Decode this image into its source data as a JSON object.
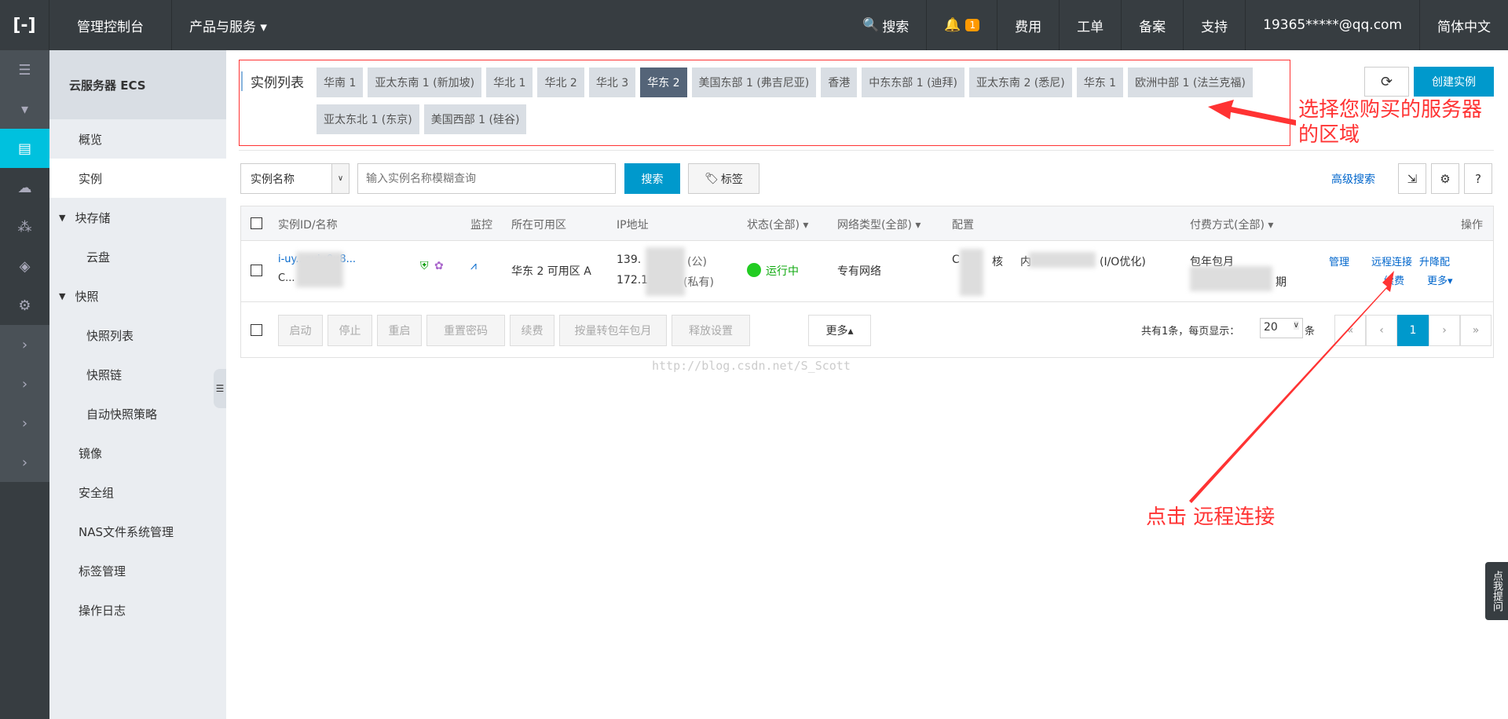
{
  "topbar": {
    "logo": "[-]",
    "console": "管理控制台",
    "products": "产品与服务 ▾",
    "search": "搜索",
    "notif_count": "1",
    "items": [
      "费用",
      "工单",
      "备案",
      "支持"
    ],
    "user": "19365*****@qq.com",
    "lang": "简体中文"
  },
  "sidebar": {
    "title": "云服务器 ECS",
    "items": [
      {
        "label": "概览",
        "type": "item"
      },
      {
        "label": "实例",
        "type": "sel"
      },
      {
        "label": "块存储",
        "type": "grp"
      },
      {
        "label": "云盘",
        "type": "l2"
      },
      {
        "label": "快照",
        "type": "grp"
      },
      {
        "label": "快照列表",
        "type": "l2"
      },
      {
        "label": "快照链",
        "type": "l2"
      },
      {
        "label": "自动快照策略",
        "type": "l2"
      },
      {
        "label": "镜像",
        "type": "item"
      },
      {
        "label": "安全组",
        "type": "item"
      },
      {
        "label": "NAS文件系统管理",
        "type": "item"
      },
      {
        "label": "标签管理",
        "type": "item"
      },
      {
        "label": "操作日志",
        "type": "item"
      }
    ]
  },
  "regions": {
    "title": "实例列表",
    "active": "华东 2",
    "tabs": [
      "华南 1",
      "亚太东南 1 (新加坡)",
      "华北 1",
      "华北 2",
      "华北 3",
      "华东 2",
      "美国东部 1 (弗吉尼亚)",
      "香港",
      "中东东部 1 (迪拜)",
      "亚太东南 2 (悉尼)",
      "华东 1",
      "欧洲中部 1 (法兰克福)",
      "亚太东北 1 (东京)",
      "美国西部 1 (硅谷)"
    ]
  },
  "actions": {
    "create": "创建实例",
    "refresh_icon": "refresh-icon"
  },
  "filter": {
    "select": "实例名称",
    "placeholder": "输入实例名称模糊查询",
    "search": "搜索",
    "tag": "标签",
    "advanced": "高级搜索"
  },
  "table": {
    "headers": {
      "id": "实例ID/名称",
      "monitor": "监控",
      "zone": "所在可用区",
      "ip": "IP地址",
      "status": "状态(全部) ▾",
      "net": "网络类型(全部) ▾",
      "config": "配置",
      "pay": "付费方式(全部) ▾",
      "ops": "操作"
    },
    "row": {
      "id": "i-uy...oxju0u8...",
      "name": "C...",
      "zone": "华东 2 可用区 A",
      "ip_pub": "139.",
      "ip_pub_tag": "(公)",
      "ip_priv": "172.1",
      "ip_priv_tag": "(私有)",
      "status": "运行中",
      "net": "专有网络",
      "config_a": "C",
      "config_b": "核",
      "config_c": "内",
      "config_d": "(I/O优化)",
      "pay": "包年包月",
      "pay_end": "期",
      "ops": [
        "管理",
        "远程连接",
        "升降配",
        "续费",
        "更多▾"
      ]
    }
  },
  "footer": {
    "buttons": [
      "启动",
      "停止",
      "重启",
      "重置密码",
      "续费",
      "按量转包年包月",
      "释放设置"
    ],
    "more": "更多▴",
    "total": "共有1条，每页显示：",
    "page_size": "20",
    "unit": "条",
    "pages": [
      "«",
      "‹",
      "1",
      "›",
      "»"
    ]
  },
  "annotations": {
    "region": "选择您购买的服务器的区域",
    "click": "点击 远程连接"
  },
  "watermark": "http://blog.csdn.net/S_Scott",
  "help": "点我提问",
  "colors": {
    "accent": "#0099cc",
    "annotation": "#ff3333",
    "topbar": "#373d41"
  }
}
